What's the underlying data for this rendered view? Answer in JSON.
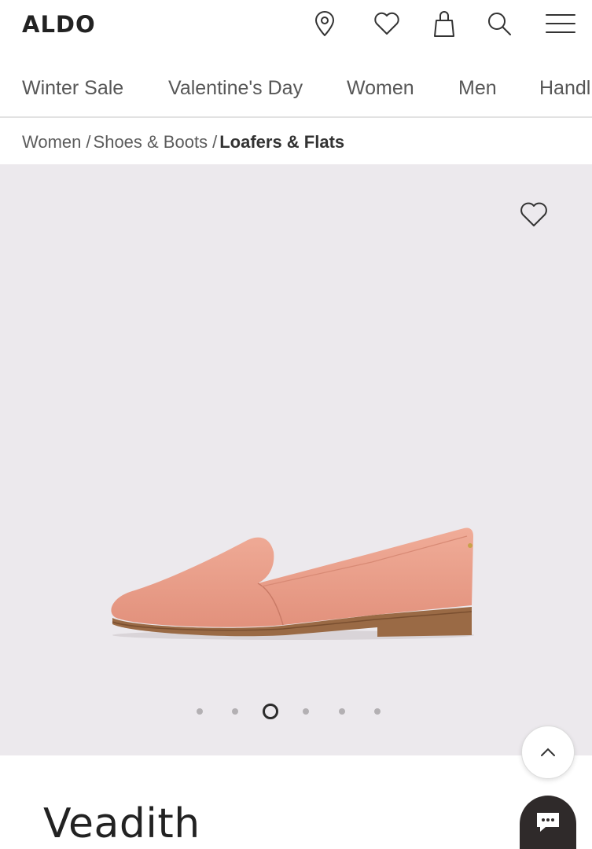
{
  "header": {
    "logo": "ALDO",
    "icons": [
      "location-pin-icon",
      "heart-icon",
      "shopping-bag-icon",
      "search-icon",
      "menu-icon"
    ]
  },
  "categories": [
    "Winter Sale",
    "Valentine's Day",
    "Women",
    "Men",
    "Handl"
  ],
  "breadcrumb": {
    "items": [
      "Women",
      "Shoes & Boots"
    ],
    "separator": "/",
    "current": "Loafers & Flats"
  },
  "gallery": {
    "background": "#ece9ed",
    "image": "pink-suede-loafer",
    "image_count": 6,
    "active_index": 3
  },
  "product": {
    "name": "Veadith"
  },
  "colors": {
    "text": "#333333",
    "shoe": "#e9a08c",
    "sole": "#9a6a45",
    "chat": "#2f2a2a"
  }
}
